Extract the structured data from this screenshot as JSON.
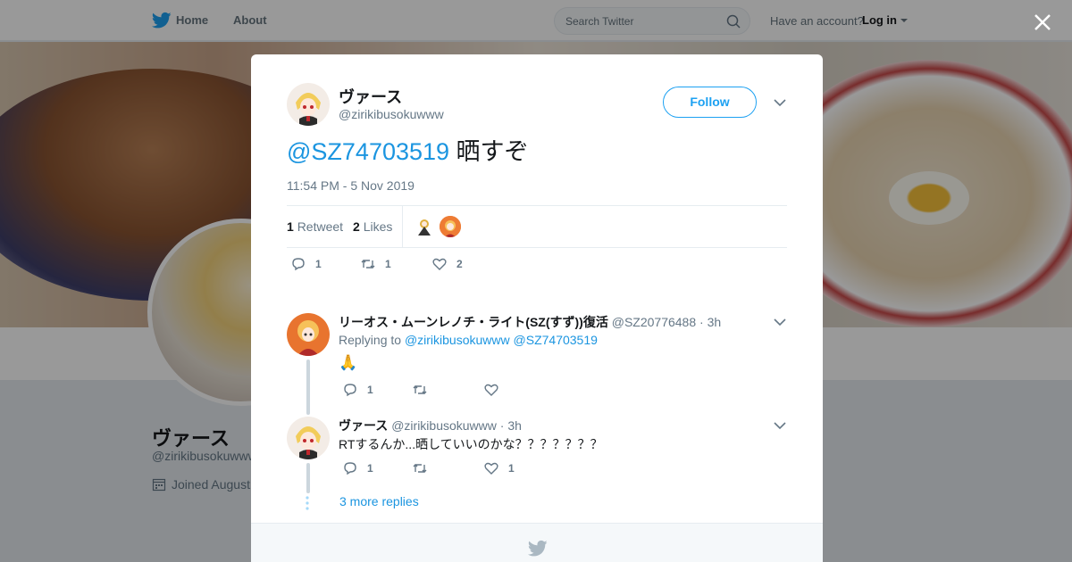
{
  "nav": {
    "home_label": "Home",
    "about_label": "About",
    "search_placeholder": "Search Twitter",
    "have_account": "Have an account?",
    "login_label": "Log in"
  },
  "profile": {
    "name": "ヴァース",
    "handle": "@zirikibusokuwww",
    "joined": "Joined August"
  },
  "tweet": {
    "author_name": "ヴァース",
    "author_handle": "@zirikibusokuwww",
    "follow_label": "Follow",
    "mention": "@SZ74703519",
    "text": " 晒すぞ",
    "timestamp": "11:54 PM - 5 Nov 2019",
    "retweets_count": "1",
    "retweets_label": "Retweet",
    "likes_count": "2",
    "likes_label": "Likes",
    "actions": {
      "replies": "1",
      "retweets": "1",
      "likes": "2"
    }
  },
  "replies": [
    {
      "name": "リーオス・ムーンレノチ・ライト(SZ(すず))復活",
      "handle": "@SZ20776488",
      "sep": "·",
      "time": "3h",
      "replying_label": "Replying to",
      "replying_to_1": "@zirikibusokuwww",
      "replying_to_2": "@SZ74703519",
      "text": "🙏",
      "replies": "1",
      "retweets": "",
      "likes": ""
    },
    {
      "name": "ヴァース",
      "handle": "@zirikibusokuwww",
      "sep": "·",
      "time": "3h",
      "text": "RTするんか...晒していいのかな？？？？？？？",
      "replies": "1",
      "retweets": "",
      "likes": "1"
    }
  ],
  "more_replies": "3 more replies",
  "colors": {
    "accent": "#1da1f2",
    "link": "#1b95e0",
    "text": "#14171a",
    "muted": "#657786"
  }
}
